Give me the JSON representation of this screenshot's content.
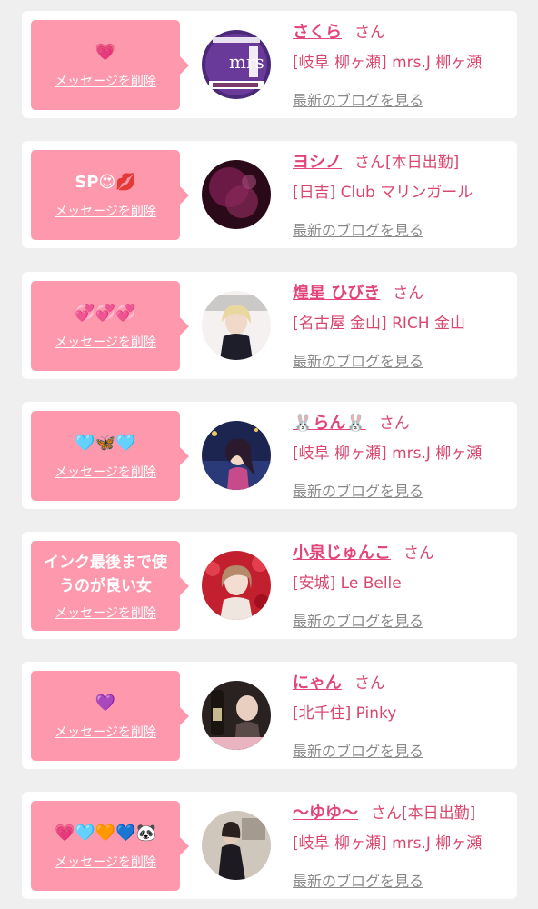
{
  "delete_label": "メッセージを削除",
  "san_label": "さん",
  "blog_label": "最新のブログを見る",
  "colors": {
    "background": "#efefef",
    "bubble": "#fd98ad",
    "name": "#e2457a",
    "muted": "#8a8a8a"
  },
  "entries": [
    {
      "message": "💗",
      "name": "さくら",
      "status": "",
      "shop": "[岐阜 柳ヶ瀬] mrs.J 柳ヶ瀬",
      "avatar_icon": "mrs-j-logo-avatar"
    },
    {
      "message": "SP😍💋",
      "name": "ヨシノ",
      "status": "[本日出勤]",
      "shop": "[日吉] Club マリンガール",
      "avatar_icon": "dark-photo-avatar"
    },
    {
      "message": "💞💞💞",
      "name": "煌星 ひびき",
      "status": "",
      "shop": "[名古屋 金山] RICH 金山",
      "avatar_icon": "magazine-photo-avatar"
    },
    {
      "message": "🩵🦋🩵",
      "name": "🐰らん🐰",
      "status": "",
      "shop": "[岐阜 柳ヶ瀬] mrs.J 柳ヶ瀬",
      "avatar_icon": "illustration-avatar"
    },
    {
      "message": "インク最後まで使うのが良い女",
      "name": "小泉じゅんこ",
      "status": "",
      "shop": "[安城] Le Belle",
      "avatar_icon": "red-hearts-photo-avatar"
    },
    {
      "message": "💜",
      "name": "にゃん",
      "status": "",
      "shop": "[北千住] Pinky",
      "avatar_icon": "bottle-photo-avatar"
    },
    {
      "message": "💗🩵🧡💙🐼",
      "name": "〜ゆゆ〜",
      "status": "[本日出勤]",
      "shop": "[岐阜 柳ヶ瀬] mrs.J 柳ヶ瀬",
      "avatar_icon": "dress-photo-avatar"
    }
  ]
}
